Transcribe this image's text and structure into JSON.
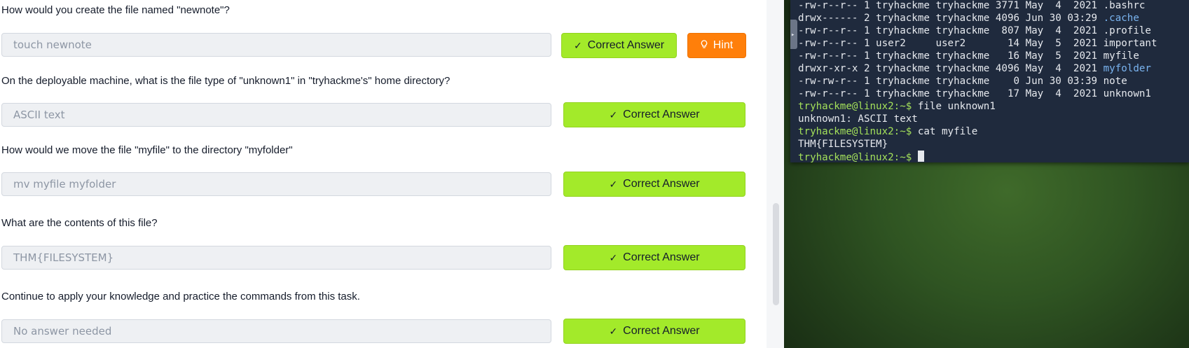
{
  "questions": [
    {
      "text": "How would you create the file named \"newnote\"?",
      "answer": "touch newnote",
      "submit_label": "Correct Answer",
      "hint_label": "Hint"
    },
    {
      "text": "On the deployable machine, what is the file type of \"unknown1\" in \"tryhackme's\" home directory?",
      "answer": "ASCII text",
      "submit_label": "Correct Answer"
    },
    {
      "text": "How would we move the file \"myfile\" to the directory \"myfolder\"",
      "answer": "mv myfile myfolder",
      "submit_label": "Correct Answer"
    },
    {
      "text": "What are the contents of this file?",
      "answer": "THM{FILESYSTEM}",
      "submit_label": "Correct Answer"
    },
    {
      "text": "Continue to apply your knowledge and practice the commands from this task.",
      "answer": "No answer needed",
      "submit_label": "Correct Answer"
    }
  ],
  "icons": {
    "check": "check-icon",
    "hint": "lightbulb-icon",
    "expand": "chevron-right-icon"
  },
  "terminal": {
    "listing": [
      {
        "perm": "-rw-r--r--",
        "links": "1",
        "user": "tryhackme",
        "group": "tryhackme",
        "size": "3771",
        "date": "May  4  2021",
        "name": ".bashrc",
        "kind": "file"
      },
      {
        "perm": "drwx------",
        "links": "2",
        "user": "tryhackme",
        "group": "tryhackme",
        "size": "4096",
        "date": "Jun 30 03:29",
        "name": ".cache",
        "kind": "dir"
      },
      {
        "perm": "-rw-r--r--",
        "links": "1",
        "user": "tryhackme",
        "group": "tryhackme",
        "size": " 807",
        "date": "May  4  2021",
        "name": ".profile",
        "kind": "file"
      },
      {
        "perm": "-rw-r--r--",
        "links": "1",
        "user": "user2    ",
        "group": "user2    ",
        "size": "  14",
        "date": "May  5  2021",
        "name": "important",
        "kind": "file"
      },
      {
        "perm": "-rw-r--r--",
        "links": "1",
        "user": "tryhackme",
        "group": "tryhackme",
        "size": "  16",
        "date": "May  5  2021",
        "name": "myfile",
        "kind": "file"
      },
      {
        "perm": "drwxr-xr-x",
        "links": "2",
        "user": "tryhackme",
        "group": "tryhackme",
        "size": "4096",
        "date": "May  4  2021",
        "name": "myfolder",
        "kind": "dir"
      },
      {
        "perm": "-rw-rw-r--",
        "links": "1",
        "user": "tryhackme",
        "group": "tryhackme",
        "size": "   0",
        "date": "Jun 30 03:39",
        "name": "note",
        "kind": "file"
      },
      {
        "perm": "-rw-r--r--",
        "links": "1",
        "user": "tryhackme",
        "group": "tryhackme",
        "size": "  17",
        "date": "May  4  2021",
        "name": "unknown1",
        "kind": "file"
      }
    ],
    "prompt": "tryhackme@linux2:~$",
    "cmd1": " file unknown1",
    "out1": "unknown1: ASCII text",
    "cmd2": " cat myfile",
    "out2": "THM{FILESYSTEM}",
    "cmd3": " ",
    "colors": {
      "prompt": "#a3e05a",
      "directory": "#7ab4f0",
      "background": "#1f2a3d"
    }
  },
  "colors": {
    "correct": "#a3ea2a",
    "hint": "#ff7f0a"
  }
}
